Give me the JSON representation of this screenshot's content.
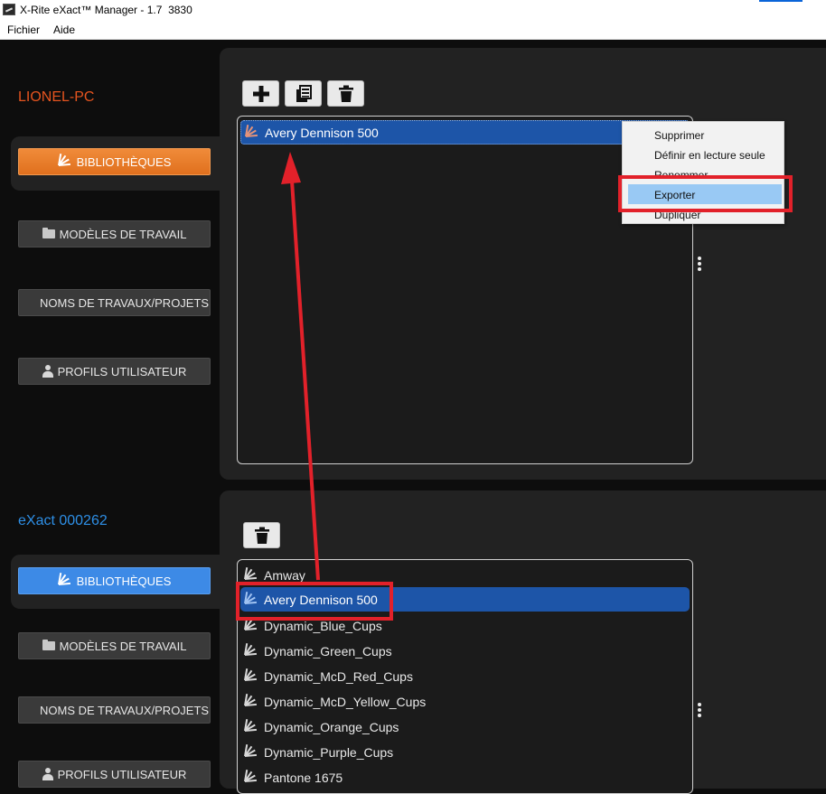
{
  "window": {
    "title": "X-Rite eXact™ Manager - 1.7  3830",
    "accent_color": "#0a64d8"
  },
  "menu": {
    "items": [
      "Fichier",
      "Aide"
    ]
  },
  "sections": {
    "top": {
      "device_name": "LIONEL-PC",
      "device_color": "#e5541f",
      "nav": [
        {
          "label": "BIBLIOTHÈQUES",
          "icon": "library-icon",
          "active": true
        },
        {
          "label": "MODÈLES DE TRAVAIL",
          "icon": "folder-icon",
          "active": false
        },
        {
          "label": "NOMS DE TRAVAUX/PROJETS",
          "icon": "",
          "active": false
        },
        {
          "label": "PROFILS UTILISATEUR",
          "icon": "user-icon",
          "active": false
        }
      ],
      "toolbar": [
        "add-icon",
        "copy-icon",
        "trash-icon"
      ],
      "list": [
        "Avery Dennison 500"
      ],
      "selected": "Avery Dennison 500"
    },
    "bottom": {
      "device_name": "eXact 000262",
      "device_color": "#2e8fe6",
      "nav": [
        {
          "label": "BIBLIOTHÈQUES",
          "icon": "library-icon",
          "active": true
        },
        {
          "label": "MODÈLES DE TRAVAIL",
          "icon": "folder-icon",
          "active": false
        },
        {
          "label": "NOMS DE TRAVAUX/PROJETS",
          "icon": "",
          "active": false
        },
        {
          "label": "PROFILS UTILISATEUR",
          "icon": "user-icon",
          "active": false
        }
      ],
      "toolbar": [
        "trash-icon"
      ],
      "list": [
        "Amway",
        "Avery Dennison 500",
        "Dynamic_Blue_Cups",
        "Dynamic_Green_Cups",
        "Dynamic_McD_Red_Cups",
        "Dynamic_McD_Yellow_Cups",
        "Dynamic_Orange_Cups",
        "Dynamic_Purple_Cups",
        "Pantone 1675"
      ],
      "selected": "Avery Dennison 500"
    }
  },
  "context_menu": {
    "items": [
      "Supprimer",
      "Définir en lecture seule",
      "Renommer",
      "Exporter",
      "Dupliquer"
    ],
    "highlighted": "Exporter"
  },
  "annotation": {
    "color": "#e2212a"
  }
}
